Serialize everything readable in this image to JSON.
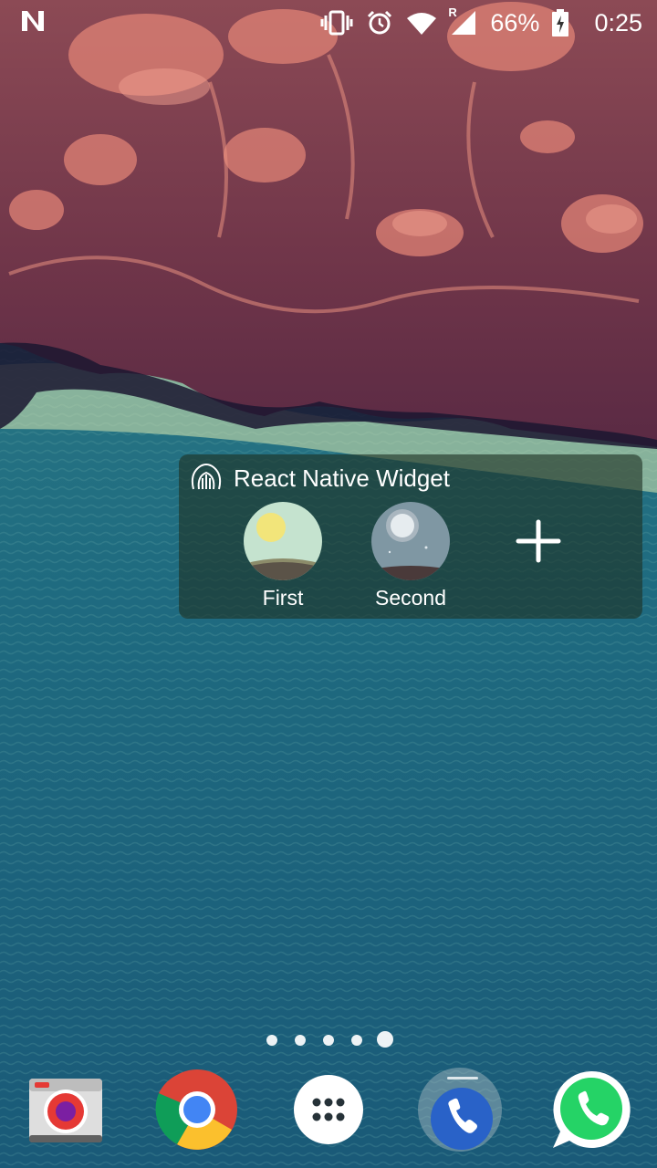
{
  "status_bar": {
    "notification_icon": "n-icon",
    "icons": [
      "vibrate-icon",
      "alarm-icon",
      "wifi-icon",
      "signal-roaming-icon",
      "battery-charging-icon"
    ],
    "roaming_indicator": "R",
    "battery": "66%",
    "time": "0:25"
  },
  "widget": {
    "title": "React Native Widget",
    "icon": "react-native-logo-icon",
    "items": [
      {
        "label": "First",
        "icon": "sunny-landscape-icon"
      },
      {
        "label": "Second",
        "icon": "moon-landscape-icon"
      }
    ],
    "add_icon": "plus-icon"
  },
  "page_indicator": {
    "pages": 5,
    "current": 5
  },
  "dock": {
    "apps": [
      {
        "name": "Camera",
        "icon": "camera-icon"
      },
      {
        "name": "Chrome",
        "icon": "chrome-icon"
      },
      {
        "name": "Apps",
        "icon": "app-drawer-icon"
      },
      {
        "name": "Phone",
        "icon": "phone-icon"
      },
      {
        "name": "WhatsApp",
        "icon": "whatsapp-icon"
      }
    ]
  },
  "colors": {
    "land": "#7a3c4f",
    "land_highlight": "#e08376",
    "sea": "#1f6b80",
    "widget_bg": "#1e3223"
  }
}
